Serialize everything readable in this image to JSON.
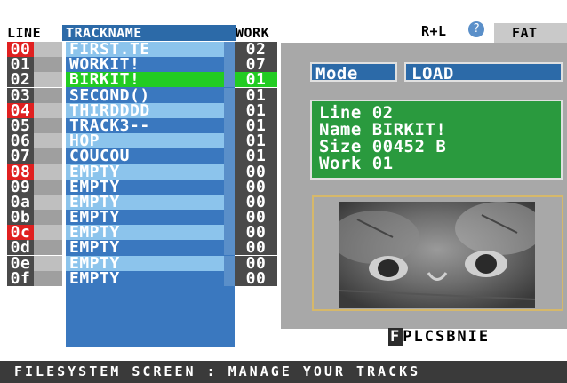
{
  "header": {
    "line_label": "LINE",
    "trackname_label": "TRACKNAME",
    "work_label": "WORK"
  },
  "top_right": {
    "rl_label": "R+L",
    "rl_icon": "help-circle-icon",
    "tab_label": "FAT"
  },
  "rows": [
    {
      "line": "00",
      "name": "FIRST.TE",
      "work": "02",
      "line_color": "#e02020",
      "name_color": "#8cc4ec",
      "selected": false
    },
    {
      "line": "01",
      "name": "WORKIT!",
      "work": "07",
      "line_color": "#4a4a4a",
      "name_color": "#3a78bf",
      "selected": false
    },
    {
      "line": "02",
      "name": "BIRKIT!",
      "work": "01",
      "line_color": "#4a4a4a",
      "name_color": "#22cc22",
      "selected": true
    },
    {
      "line": "03",
      "name": "SECOND()",
      "work": "01",
      "line_color": "#4a4a4a",
      "name_color": "#3a78bf",
      "selected": false
    },
    {
      "line": "04",
      "name": "THIRDDDD",
      "work": "01",
      "line_color": "#e02020",
      "name_color": "#8cc4ec",
      "selected": false
    },
    {
      "line": "05",
      "name": "TRACK3--",
      "work": "01",
      "line_color": "#4a4a4a",
      "name_color": "#3a78bf",
      "selected": false
    },
    {
      "line": "06",
      "name": "HOP",
      "work": "01",
      "line_color": "#4a4a4a",
      "name_color": "#8cc4ec",
      "selected": false
    },
    {
      "line": "07",
      "name": "COUCOU",
      "work": "01",
      "line_color": "#4a4a4a",
      "name_color": "#3a78bf",
      "selected": false
    },
    {
      "line": "08",
      "name": "EMPTY",
      "work": "00",
      "line_color": "#e02020",
      "name_color": "#8cc4ec",
      "selected": false
    },
    {
      "line": "09",
      "name": "EMPTY",
      "work": "00",
      "line_color": "#4a4a4a",
      "name_color": "#3a78bf",
      "selected": false
    },
    {
      "line": "0a",
      "name": "EMPTY",
      "work": "00",
      "line_color": "#4a4a4a",
      "name_color": "#8cc4ec",
      "selected": false
    },
    {
      "line": "0b",
      "name": "EMPTY",
      "work": "00",
      "line_color": "#4a4a4a",
      "name_color": "#3a78bf",
      "selected": false
    },
    {
      "line": "0c",
      "name": "EMPTY",
      "work": "00",
      "line_color": "#e02020",
      "name_color": "#8cc4ec",
      "selected": false
    },
    {
      "line": "0d",
      "name": "EMPTY",
      "work": "00",
      "line_color": "#4a4a4a",
      "name_color": "#3a78bf",
      "selected": false
    },
    {
      "line": "0e",
      "name": "EMPTY",
      "work": "00",
      "line_color": "#4a4a4a",
      "name_color": "#8cc4ec",
      "selected": false
    },
    {
      "line": "0f",
      "name": "EMPTY",
      "work": "00",
      "line_color": "#4a4a4a",
      "name_color": "#3a78bf",
      "selected": false
    }
  ],
  "mode": {
    "label": "Mode",
    "value": "LOAD"
  },
  "info": {
    "line_label": "Line",
    "line_value": "02",
    "name_label": "Name",
    "name_value": "BIRKIT!",
    "size_label": "Size",
    "size_value": "00452 B",
    "work_label": "Work",
    "work_value": "01"
  },
  "screen_letters": {
    "selected": "F",
    "rest": "PLCSBNIE"
  },
  "status_bar": "FILESYSTEM SCREEN : MANAGE YOUR TRACKS",
  "colors": {
    "selected_row": "#22cc22",
    "info_panel": "#2a9a3e",
    "accent_blue": "#2c6aa8",
    "status_bar": "#3a3a3a"
  }
}
